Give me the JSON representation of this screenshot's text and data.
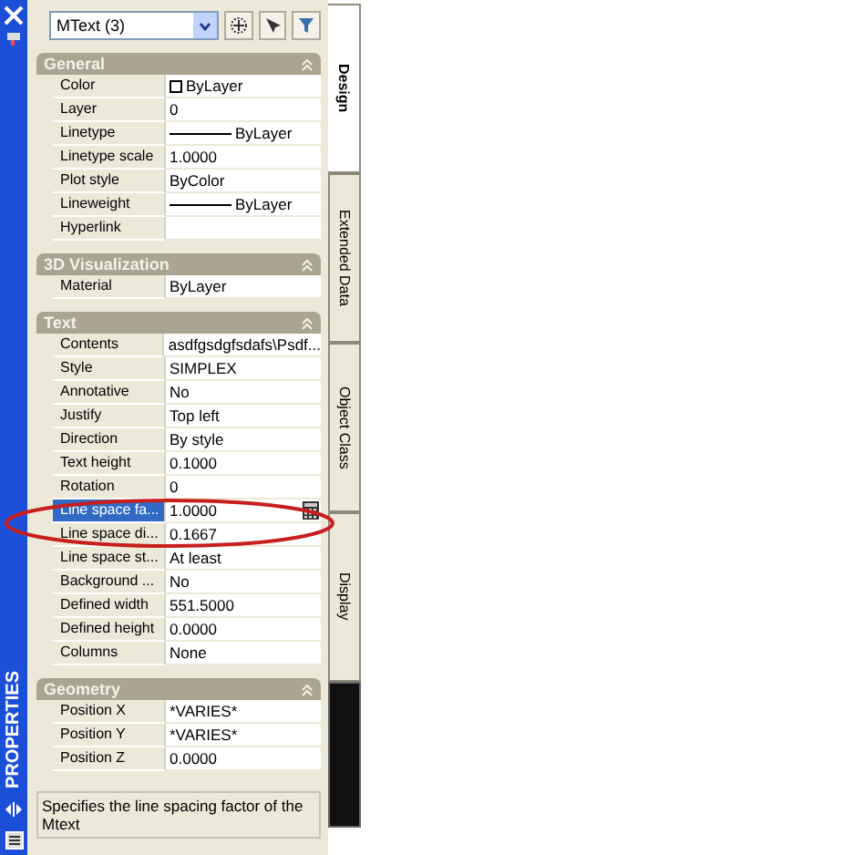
{
  "selector": {
    "value": "MText (3)"
  },
  "side_bar": {
    "title": "PROPERTIES"
  },
  "sections": [
    {
      "title": "General",
      "expanded": true,
      "rows": [
        {
          "label": "Color",
          "value": "ByLayer",
          "kind": "swatch",
          "selected": false
        },
        {
          "label": "Layer",
          "value": "0",
          "selected": false
        },
        {
          "label": "Linetype",
          "value": "ByLayer",
          "kind": "line",
          "selected": false
        },
        {
          "label": "Linetype scale",
          "value": "1.0000",
          "selected": false
        },
        {
          "label": "Plot style",
          "value": "ByColor",
          "selected": false
        },
        {
          "label": "Lineweight",
          "value": "ByLayer",
          "kind": "line",
          "selected": false
        },
        {
          "label": "Hyperlink",
          "value": "",
          "selected": false
        }
      ]
    },
    {
      "title": "3D Visualization",
      "expanded": true,
      "rows": [
        {
          "label": "Material",
          "value": "ByLayer",
          "selected": false
        }
      ]
    },
    {
      "title": "Text",
      "expanded": true,
      "rows": [
        {
          "label": "Contents",
          "value": "asdfgsdgfsdafs\\Psdf...",
          "selected": false
        },
        {
          "label": "Style",
          "value": "SIMPLEX",
          "selected": false
        },
        {
          "label": "Annotative",
          "value": "No",
          "selected": false
        },
        {
          "label": "Justify",
          "value": "Top left",
          "selected": false
        },
        {
          "label": "Direction",
          "value": "By style",
          "selected": false
        },
        {
          "label": "Text height",
          "value": "0.1000",
          "selected": false
        },
        {
          "label": "Rotation",
          "value": "0",
          "selected": false
        },
        {
          "label": "Line space fa...",
          "value": "1.0000",
          "kind": "calculator",
          "selected": true
        },
        {
          "label": "Line space di...",
          "value": "0.1667",
          "selected": false
        },
        {
          "label": "Line space st...",
          "value": "At least",
          "selected": false
        },
        {
          "label": "Background ...",
          "value": "No",
          "selected": false
        },
        {
          "label": "Defined width",
          "value": "551.5000",
          "selected": false
        },
        {
          "label": "Defined height",
          "value": "0.0000",
          "selected": false
        },
        {
          "label": "Columns",
          "value": "None",
          "selected": false
        }
      ]
    },
    {
      "title": "Geometry",
      "expanded": true,
      "rows": [
        {
          "label": "Position X",
          "value": "*VARIES*",
          "selected": false
        },
        {
          "label": "Position Y",
          "value": "*VARIES*",
          "selected": false
        },
        {
          "label": "Position Z",
          "value": "0.0000",
          "selected": false
        }
      ]
    }
  ],
  "description": "Specifies the line spacing factor of the Mtext",
  "tabs": [
    {
      "label": "Design",
      "selected": true
    },
    {
      "label": "Extended Data",
      "selected": false
    },
    {
      "label": "Object Class",
      "selected": false
    },
    {
      "label": "Display",
      "selected": false
    }
  ]
}
